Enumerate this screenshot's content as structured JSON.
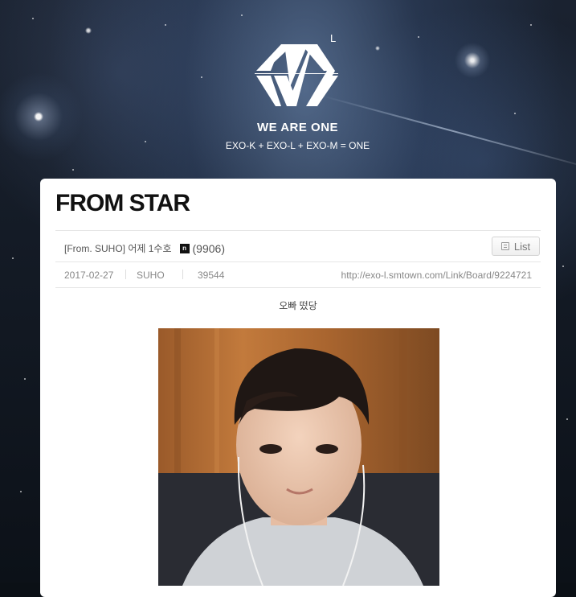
{
  "header": {
    "logo_mark": "L",
    "slogan": "WE ARE ONE",
    "sub_slogan": "EXO-K + EXO-L + EXO-M = ONE"
  },
  "board": {
    "title": "FROM STAR",
    "post": {
      "title": "[From. SUHO] 어제 1수호",
      "badge": "n",
      "comment_count": "(9906)",
      "list_button": "List",
      "date": "2017-02-27",
      "author": "SUHO",
      "views": "39544",
      "link": "http://exo-l.smtown.com/Link/Board/9224721",
      "body": "오빠 떴당"
    }
  }
}
